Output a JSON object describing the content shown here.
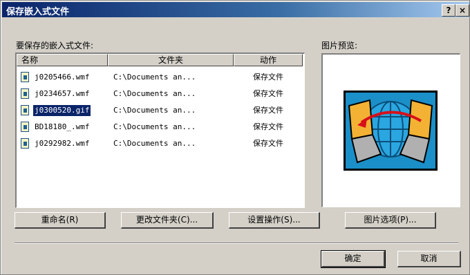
{
  "window": {
    "title": "保存嵌入式文件",
    "help_glyph": "?",
    "close_glyph": "×"
  },
  "labels": {
    "files_label": "要保存的嵌入式文件:",
    "preview_label": "图片预览:"
  },
  "columns": [
    "名称",
    "文件夹",
    "动作"
  ],
  "rows": [
    {
      "name": "j0205466.wmf",
      "folder": "C:\\Documents an...",
      "action": "保存文件",
      "selected": false,
      "icon": "wmf-file-icon"
    },
    {
      "name": "j0234657.wmf",
      "folder": "C:\\Documents an...",
      "action": "保存文件",
      "selected": false,
      "icon": "wmf-file-icon"
    },
    {
      "name": "j0300520.gif",
      "folder": "C:\\Documents an...",
      "action": "保存文件",
      "selected": true,
      "icon": "gif-file-icon"
    },
    {
      "name": "BD18180_.wmf",
      "folder": "C:\\Documents an...",
      "action": "保存文件",
      "selected": false,
      "icon": "wmf-file-icon"
    },
    {
      "name": "j0292982.wmf",
      "folder": "C:\\Documents an...",
      "action": "保存文件",
      "selected": false,
      "icon": "wmf-file-icon"
    }
  ],
  "buttons": {
    "rename": "重命名(R)",
    "change_folder": "更改文件夹(C)...",
    "set_action": "设置操作(S)...",
    "picture_options": "图片选项(P)...",
    "ok": "确定",
    "cancel": "取消"
  },
  "colors": {
    "titlebar": "#0a246a",
    "selection": "#0a246a",
    "dialog_bg": "#d4d0c8"
  }
}
